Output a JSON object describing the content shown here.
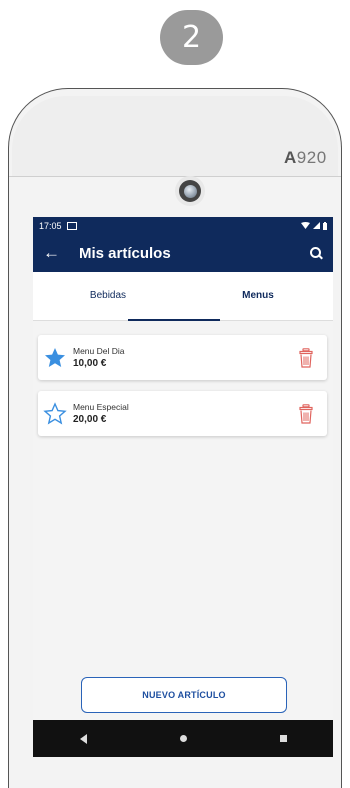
{
  "step": {
    "number": "2"
  },
  "device": {
    "brand_prefix": "A",
    "brand_model": "920"
  },
  "status_bar": {
    "time": "17:05"
  },
  "app_bar": {
    "title": "Mis artículos",
    "back_icon": "arrow-left-icon",
    "search_icon": "search-icon"
  },
  "tabs": [
    {
      "label": "Bebidas",
      "active": false
    },
    {
      "label": "Menus",
      "active": true
    }
  ],
  "items": [
    {
      "name": "Menu Del Dia",
      "price": "10,00 €",
      "favorite": true
    },
    {
      "name": "Menu Especial",
      "price": "20,00 €",
      "favorite": false
    }
  ],
  "new_item_button": {
    "label": "NUEVO ARTÍCULO"
  },
  "colors": {
    "primary": "#0f2a5c",
    "star": "#3a8fe0",
    "trash": "#e0645e",
    "button_border": "#2a63b8"
  }
}
